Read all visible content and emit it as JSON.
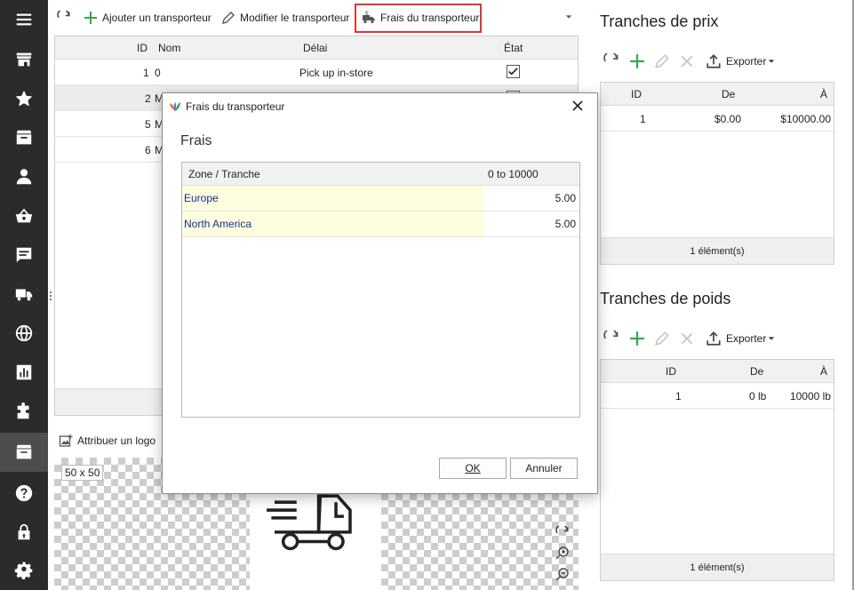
{
  "toolbar": {
    "add_label": "Ajouter un transporteur",
    "edit_label": "Modifier le transporteur",
    "fees_label": "Frais du transporteur"
  },
  "carriers_grid": {
    "columns": [
      "ID",
      "Nom",
      "Délai",
      "État"
    ],
    "rows": [
      {
        "id": "1",
        "name": "0",
        "delay": "Pick up in-store",
        "active": true
      },
      {
        "id": "2",
        "name": "M",
        "delay": "",
        "active": false
      },
      {
        "id": "5",
        "name": "M",
        "delay": "",
        "active": false
      },
      {
        "id": "6",
        "name": "M",
        "delay": "",
        "active": false
      }
    ]
  },
  "logo_panel": {
    "assign_label": "Attribuer un logo",
    "size_label": "50 x 50"
  },
  "dialog": {
    "title": "Frais du transporteur",
    "heading": "Frais",
    "columns": [
      "Zone / Tranche",
      "0 to 10000"
    ],
    "rows": [
      {
        "zone": "Europe",
        "value": "5.00"
      },
      {
        "zone": "North America",
        "value": "5.00"
      }
    ],
    "ok_label": "OK",
    "cancel_label": "Annuler"
  },
  "price_ranges": {
    "title": "Tranches de prix",
    "export_label": "Exporter",
    "columns": [
      "ID",
      "De",
      "À"
    ],
    "rows": [
      {
        "id": "1",
        "from": "$0.00",
        "to": "$10000.00"
      }
    ],
    "footer": "1 élément(s)"
  },
  "weight_ranges": {
    "title": "Tranches de poids",
    "export_label": "Exporter",
    "columns": [
      "ID",
      "De",
      "À"
    ],
    "rows": [
      {
        "id": "1",
        "from": "0 lb",
        "to": "10000 lb"
      }
    ],
    "footer": "1 élément(s)"
  },
  "colors": {
    "sidebar_bg": "#2b2b2b",
    "accent_green": "#3aa84a",
    "highlight_red": "#d9373a",
    "zone_link": "#1c2f8c",
    "zone_cell_bg": "#fdfde0"
  },
  "icons": [
    "menu-icon",
    "store-icon",
    "star-icon",
    "inbox-icon",
    "person-icon",
    "basket-icon",
    "message-icon",
    "truck-icon",
    "globe-icon",
    "chart-icon",
    "puzzle-icon",
    "archive-icon",
    "help-icon",
    "lock-icon",
    "gear-icon"
  ]
}
